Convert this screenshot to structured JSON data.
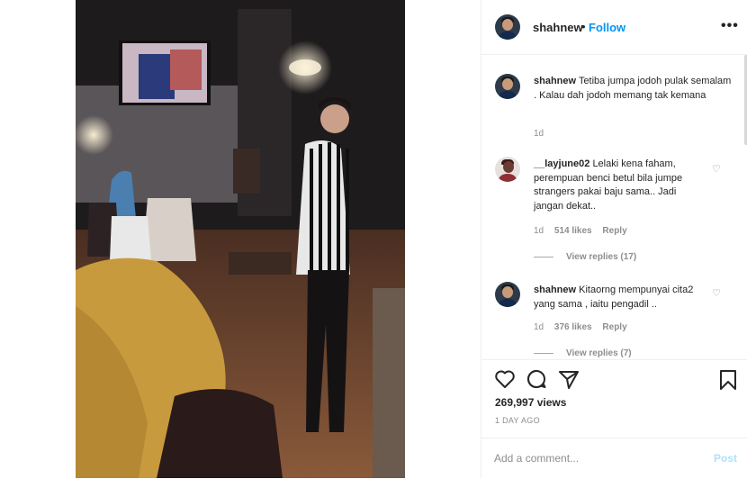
{
  "colors": {
    "accent": "#0095f6",
    "post_disabled": "#b2dffc",
    "muted": "#8e8e8e",
    "text": "#262626"
  },
  "header": {
    "username": "shahnew",
    "separator": "•",
    "follow_label": "Follow",
    "more_icon": "more-horizontal-icon",
    "more_label": "•••"
  },
  "caption": {
    "username": "shahnew",
    "text": "Tetiba jumpa jodoh pulak semalam . Kalau dah jodoh memang tak kemana",
    "time": "1d"
  },
  "comments": [
    {
      "username": "__layjune02",
      "text": "Lelaki kena faham, perempuan benci betul bila jumpe strangers pakai baju sama.. Jadi jangan dekat..",
      "time": "1d",
      "likes": "514 likes",
      "reply": "Reply",
      "view_replies": "View replies (17)"
    },
    {
      "username": "shahnew",
      "text": "Kitaorng mempunyai cita2 yang sama , iaitu pengadil ..",
      "time": "1d",
      "likes": "376 likes",
      "reply": "Reply",
      "view_replies": "View replies (7)"
    }
  ],
  "actions": {
    "icons": [
      "heart-icon",
      "comment-icon",
      "share-icon",
      "bookmark-icon"
    ],
    "views": "269,997 views",
    "posted": "1 DAY AGO"
  },
  "add_comment": {
    "placeholder": "Add a comment...",
    "post_label": "Post"
  }
}
